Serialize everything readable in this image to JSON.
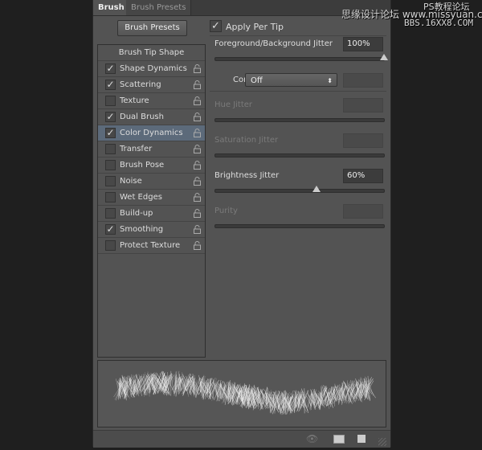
{
  "tabs": [
    {
      "label": "Brush",
      "active": true
    },
    {
      "label": "Brush Presets",
      "active": false
    }
  ],
  "brush_presets_button": "Brush Presets",
  "list": {
    "header": "Brush Tip Shape",
    "items": [
      {
        "label": "Shape Dynamics",
        "checked": true
      },
      {
        "label": "Scattering",
        "checked": true
      },
      {
        "label": "Texture",
        "checked": false
      },
      {
        "label": "Dual Brush",
        "checked": true
      },
      {
        "label": "Color Dynamics",
        "checked": true,
        "selected": true
      },
      {
        "label": "Transfer",
        "checked": false
      },
      {
        "label": "Brush Pose",
        "checked": false
      },
      {
        "label": "Noise",
        "checked": false
      },
      {
        "label": "Wet Edges",
        "checked": false
      },
      {
        "label": "Build-up",
        "checked": false
      },
      {
        "label": "Smoothing",
        "checked": true
      },
      {
        "label": "Protect Texture",
        "checked": false
      }
    ]
  },
  "apply_per_tip": {
    "label": "Apply Per Tip",
    "checked": true
  },
  "fg_bg_jitter": {
    "label": "Foreground/Background Jitter",
    "value": "100%",
    "percent": 100
  },
  "control": {
    "label": "Control:",
    "value": "Off"
  },
  "hue_jitter": {
    "label": "Hue Jitter",
    "value": "",
    "percent": 0,
    "disabled": true
  },
  "saturation_jitter": {
    "label": "Saturation Jitter",
    "value": "",
    "percent": 0,
    "disabled": true
  },
  "brightness_jitter": {
    "label": "Brightness Jitter",
    "value": "60%",
    "percent": 60
  },
  "purity": {
    "label": "Purity",
    "value": "",
    "percent": 0,
    "disabled": true
  },
  "watermark": {
    "line1": "思缘设计论坛 www.missyuan.com",
    "line2a": "PS教程论坛",
    "line2b": "BBS.16XX8.COM"
  },
  "colors": {
    "panel": "#535353",
    "selected_row": "#5c6a7a",
    "background": "#1f1f1f"
  }
}
